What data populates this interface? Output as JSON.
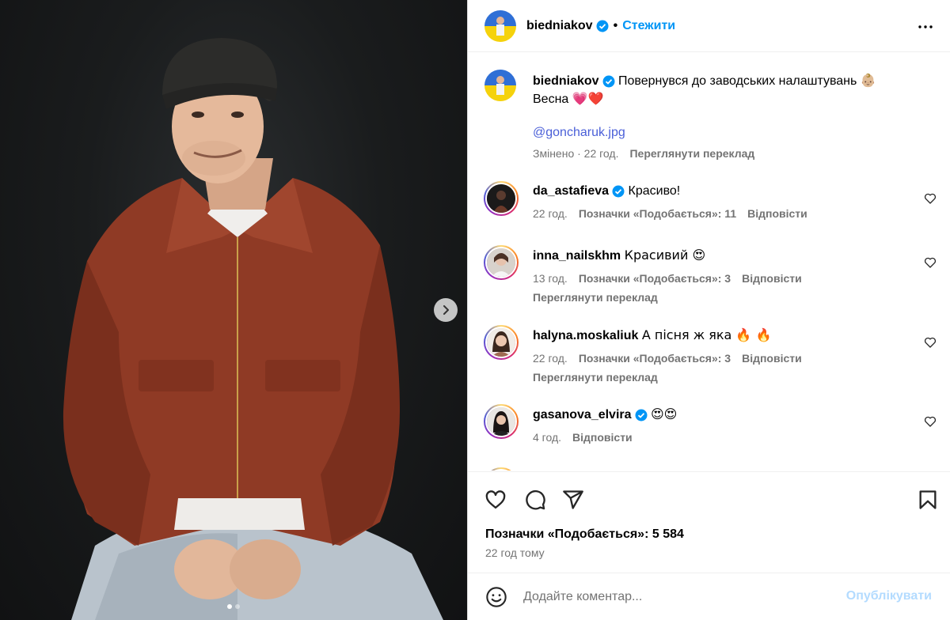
{
  "post": {
    "username": "biedniakov",
    "follow_label": "Стежити",
    "separator": "•"
  },
  "caption": {
    "username": "biedniakov",
    "line1": "Повернувся до заводських налаштувань",
    "line1_emoji": "👶🏼",
    "line2": "Весна",
    "line2_emoji": "💗❤️",
    "mention": "@goncharuk.jpg",
    "edited": "Змінено · 22 год.",
    "translate_label": "Переглянути переклад"
  },
  "comments": [
    {
      "username": "da_astafieva",
      "verified": true,
      "text": "Красиво!",
      "time": "22 год.",
      "likes": "Позначки «Подобається»: 11",
      "reply": "Відповісти",
      "translate": ""
    },
    {
      "username": "inna_nailskhm",
      "verified": false,
      "text": "Красивий 😍",
      "time": "13 год.",
      "likes": "Позначки «Подобається»: 3",
      "reply": "Відповісти",
      "translate": "Переглянути переклад"
    },
    {
      "username": "halyna.moskaliuk",
      "verified": false,
      "text": "А пісня ж яка 🔥 🔥",
      "time": "22 год.",
      "likes": "Позначки «Подобається»: 3",
      "reply": "Відповісти",
      "translate": "Переглянути переклад"
    },
    {
      "username": "gasanova_elvira",
      "verified": true,
      "text": "😍😍",
      "time": "4 год.",
      "likes": "",
      "reply": "Відповісти",
      "translate": ""
    }
  ],
  "footer": {
    "likes_label": "Позначки «Подобається»: 5 584",
    "time_ago": "22 год тому",
    "comment_placeholder": "Додайте коментар...",
    "post_label": "Опублікувати"
  },
  "colors": {
    "accent": "#0095f6",
    "mention": "#4a5fd8",
    "muted": "#737373",
    "post_disabled": "#b3dbff"
  },
  "carousel": {
    "slide_count": 2,
    "active_slide": 1
  }
}
